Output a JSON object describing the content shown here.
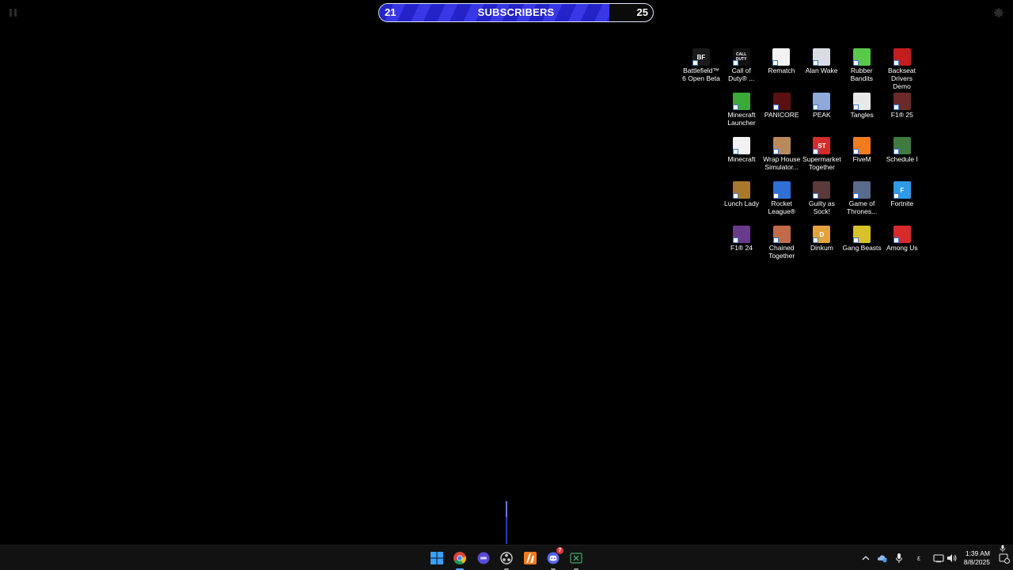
{
  "subscriber_bar": {
    "current": "21",
    "goal": "25",
    "title": "SUBSCRIBERS",
    "progress_fraction": 0.84,
    "fill_color": "#2323c8",
    "stripe_color": "#3838e6",
    "border_color": "#dfe3ff"
  },
  "desktop_icons": [
    {
      "name": "battlefield-6-open-beta",
      "label": "Battlefield™ 6 Open Beta",
      "color": "#1a1a1a",
      "glyph": "BF"
    },
    {
      "name": "call-of-duty",
      "label": "Call of Duty® ...",
      "color": "#111111",
      "glyph": "CALL DUTY"
    },
    {
      "name": "rematch",
      "label": "Rematch",
      "color": "#f2f2f2",
      "glyph": ""
    },
    {
      "name": "alan-wake",
      "label": "Alan Wake",
      "color": "#d9dde3",
      "glyph": ""
    },
    {
      "name": "rubber-bandits",
      "label": "Rubber Bandits",
      "color": "#58c84a",
      "glyph": ""
    },
    {
      "name": "backseat-drivers-demo",
      "label": "Backseat Drivers Demo",
      "color": "#c41e1e",
      "glyph": ""
    },
    {
      "name": "minecraft-launcher",
      "label": "Minecraft Launcher",
      "color": "#3aa93a",
      "glyph": ""
    },
    {
      "name": "panicore",
      "label": "PANICORE",
      "color": "#5a1010",
      "glyph": ""
    },
    {
      "name": "peak",
      "label": "PEAK",
      "color": "#8fa9d8",
      "glyph": ""
    },
    {
      "name": "tangles",
      "label": "Tangles",
      "color": "#e9e9e9",
      "glyph": ""
    },
    {
      "name": "f1-25",
      "label": "F1® 25",
      "color": "#6b2a2a",
      "glyph": ""
    },
    {
      "name": "minecraft",
      "label": "Minecraft",
      "color": "#f2f2f2",
      "glyph": ""
    },
    {
      "name": "wrap-house-simulator",
      "label": "Wrap House Simulator...",
      "color": "#b98a5c",
      "glyph": ""
    },
    {
      "name": "supermarket-together",
      "label": "Supermarket Together",
      "color": "#d42b2b",
      "glyph": "ST"
    },
    {
      "name": "fivem",
      "label": "FiveM",
      "color": "#f27b1d",
      "glyph": ""
    },
    {
      "name": "schedule-i",
      "label": "Schedule I",
      "color": "#3f7a3f",
      "glyph": ""
    },
    {
      "name": "lunch-lady",
      "label": "Lunch Lady",
      "color": "#a8782e",
      "glyph": ""
    },
    {
      "name": "rocket-league",
      "label": "Rocket League®",
      "color": "#2f6fd6",
      "glyph": ""
    },
    {
      "name": "guilty-as-sock",
      "label": "Guilty as Sock!",
      "color": "#5a3a3a",
      "glyph": ""
    },
    {
      "name": "game-of-thrones",
      "label": "Game of Thrones...",
      "color": "#5a6a8a",
      "glyph": ""
    },
    {
      "name": "fortnite",
      "label": "Fortnite",
      "color": "#2f9ae8",
      "glyph": "F"
    },
    {
      "name": "f1-24",
      "label": "F1® 24",
      "color": "#6a3a8a",
      "glyph": ""
    },
    {
      "name": "chained-together",
      "label": "Chained Together",
      "color": "#c26a4a",
      "glyph": ""
    },
    {
      "name": "dinkum",
      "label": "Dinkum",
      "color": "#e2a43a",
      "glyph": "D"
    },
    {
      "name": "gang-beasts",
      "label": "Gang Beasts",
      "color": "#d8c22a",
      "glyph": ""
    },
    {
      "name": "among-us",
      "label": "Among Us",
      "color": "#d82a2a",
      "glyph": ""
    }
  ],
  "taskbar": {
    "apps": [
      {
        "name": "start-button",
        "icon": "windows-icon"
      },
      {
        "name": "chrome-taskbar-button",
        "icon": "chrome-icon"
      },
      {
        "name": "app-taskbar-button",
        "icon": "purple-app-icon"
      },
      {
        "name": "obs-taskbar-button",
        "icon": "obs-icon"
      },
      {
        "name": "fivem-taskbar-button",
        "icon": "fivem-icon"
      },
      {
        "name": "discord-taskbar-button",
        "icon": "discord-icon",
        "badge": "7"
      },
      {
        "name": "excel-taskbar-button",
        "icon": "excel-icon"
      }
    ],
    "tray": {
      "language": "ε",
      "time": "1:39 AM",
      "date": "8/8/2025"
    }
  }
}
